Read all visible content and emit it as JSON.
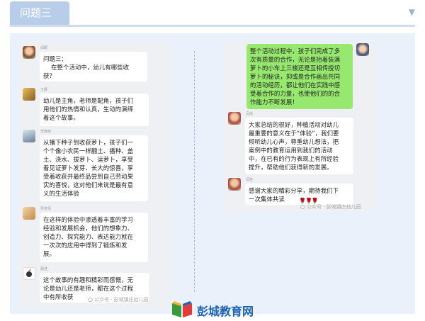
{
  "header": {
    "title": "问题三",
    "arrow_icon": "chevron-down-icon"
  },
  "left_panel": {
    "messages": [
      {
        "name": "闻颖",
        "text": "问题三：\n    在整个活动中，幼儿有哪些收\n获？"
      },
      {
        "name": "王蕾",
        "text": "幼儿是主角，老师是配角，孩子们\n用他们的热情和认真，生动的演绎\n着这个故事。"
      },
      {
        "name": "李晓晓",
        "text": "从播下种子到收获萝卜，孩子们一\n个个像小农民一样翻土、播种、盖\n土、浇水、拔萝卜、运萝卜，享受\n着见证萝卜发芽、长大的惊喜，享\n受着收获并最终品尝到自己劳动果\n实的喜悦，这对他们来说是最有意\n义的生活体验"
      },
      {
        "name": "罗老师",
        "text": "在这样的体验中渗透着丰富的学习\n经验和发展机会，他们的想象力、\n创造力、探究能力、表达能力就在\n一次次的应用中得到了锻炼和发\n展。"
      },
      {
        "name": "顾佳",
        "text": "这个故事的有趣和精彩而感慨，无\n论是幼儿还是老师，都在这个过程\n中有所收获"
      }
    ],
    "watermark": "公众号 · 彭城镇庄幼儿园"
  },
  "right_panel": {
    "messages": [
      {
        "name": "",
        "text": "整个活动过程中，孩子们完成了多\n次有质量的合作，无论是抬着装满\n萝卜的小车上三楼还是互相传授切\n萝卜的秘诀，抑或是合作画出共同\n的活动经历，都让他们在实践中感\n受着合作的力量，也使他们的的合\n作能力不断发展！"
      },
      {
        "name": "闫成",
        "text": "大家总结的很好，种植活动对幼儿\n最重要的意义在于“体验”，我们要\n倾听幼儿心声，尊重幼儿想法，把\n案例中的教育运用到我们的活动\n中，在已有的行为表现上有所经验\n提升，帮助他们获得新的发展。"
      },
      {
        "name": "闫佳",
        "text": "感谢大家的精彩分享，期待我们下\n一次集体共读"
      }
    ],
    "flowers": "🌹🌹🌹",
    "watermark": "公众号 · 彭城镇庄幼儿园"
  },
  "footer": {
    "logo_text": "彭城教育网"
  },
  "colors": {
    "accent": "#b7cdea",
    "frame": "#eaf1fa",
    "panel": "#eef0f3",
    "green_bubble": "#97e86e",
    "logo": "#1c64b3"
  }
}
